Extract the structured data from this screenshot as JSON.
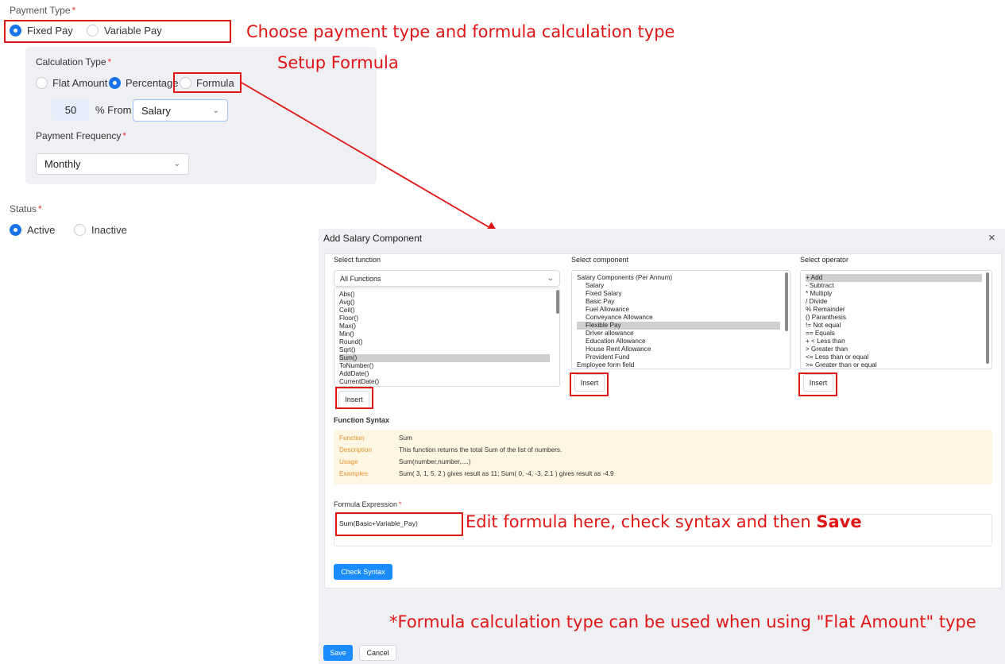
{
  "payment_type": {
    "label": "Payment Type",
    "required_mark": "*",
    "options": [
      "Fixed Pay",
      "Variable Pay"
    ],
    "selected": "Fixed Pay"
  },
  "calculation_type": {
    "label": "Calculation Type",
    "required_mark": "*",
    "options": [
      "Flat Amount",
      "Percentage",
      "Formula"
    ],
    "selected": "Percentage",
    "percent_value": "50",
    "percent_from_label": "% From",
    "from_select": "Salary"
  },
  "payment_frequency": {
    "label": "Payment Frequency",
    "required_mark": "*",
    "value": "Monthly"
  },
  "status": {
    "label": "Status",
    "required_mark": "*",
    "options": [
      "Active",
      "Inactive"
    ],
    "selected": "Active"
  },
  "annotations": {
    "choose": "Choose payment type and formula calculation type",
    "setup": "Setup Formula",
    "edit_prefix": "Edit formula here, check syntax and then ",
    "edit_bold": "Save",
    "footnote": "*Formula calculation type can be used when using \"Flat Amount\" type"
  },
  "modal": {
    "title": "Add Salary Component",
    "close_icon": "×",
    "select_function_label": "Select function",
    "function_filter": "All Functions",
    "functions": [
      "Abs()",
      "Avg()",
      "Ceil()",
      "Floor()",
      "Max()",
      "Min()",
      "Round()",
      "Sqrt()",
      "Sum()",
      "ToNumber()",
      "AddDate()",
      "CurrentDate()"
    ],
    "selected_function": "Sum()",
    "select_component_label": "Select component",
    "components": [
      "Salary Components (Per Annum)",
      "Salary",
      "Fixed Salary",
      "Basic Pay",
      "Fuel Allowance",
      "Conveyance Allowance",
      "Flexible Pay",
      "Driver allowance",
      "Education Allowance",
      "House Rent Allowance",
      "Provident Fund",
      "Employee form field"
    ],
    "selected_component": "Flexible Pay",
    "select_operator_label": "Select operator",
    "operators": [
      "+ Add",
      "- Subtract",
      "* Multiply",
      "/ Divide",
      "% Remainder",
      "() Paranthesis",
      "!= Not equal",
      "== Equals",
      "+ < Less than",
      "> Greater than",
      "<= Less than or equal",
      ">= Greater than or equal"
    ],
    "selected_operator": "+ Add",
    "insert_label": "Insert",
    "function_syntax_heading": "Function Syntax",
    "syntax": {
      "function_key": "Function",
      "function_val": "Sum",
      "description_key": "Description",
      "description_val": "This function returns the total Sum of the list of numbers.",
      "usage_key": "Usage",
      "usage_val": "Sum(number,number,....)",
      "examples_key": "Examples",
      "examples_val": "Sum( 3, 1, 5, 2 ) gives result as 11; Sum( 0, -4, -3, 2.1 ) gives result as -4.9"
    },
    "formula_expression_label": "Formula Expression",
    "formula_required": "*",
    "formula_value": "Sum(Basic+Variable_Pay)",
    "check_syntax_label": "Check Syntax",
    "save_label": "Save",
    "cancel_label": "Cancel"
  }
}
